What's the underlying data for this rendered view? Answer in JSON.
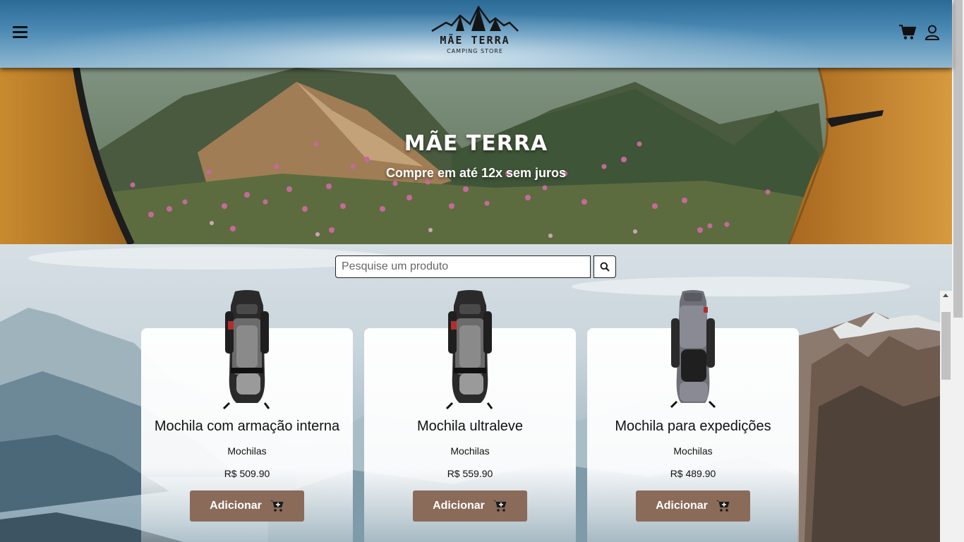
{
  "header": {
    "logo": {
      "title": "MÃE TERRA",
      "subtitle": "CAMPING STORE"
    },
    "icons": {
      "menu": "hamburger-menu-icon",
      "cart": "shopping-cart-icon",
      "user": "user-icon"
    }
  },
  "hero": {
    "title": "MÃE TERRA",
    "subtitle": "Compre em até 12x sem juros"
  },
  "search": {
    "placeholder": "Pesquise um produto",
    "value": "",
    "icon": "search-icon"
  },
  "products": [
    {
      "name": "Mochila com armação interna",
      "category": "Mochilas",
      "price": "R$ 509.90",
      "button_label": "Adicionar"
    },
    {
      "name": "Mochila ultraleve",
      "category": "Mochilas",
      "price": "R$ 559.90",
      "button_label": "Adicionar"
    },
    {
      "name": "Mochila para expedições",
      "category": "Mochilas",
      "price": "R$ 489.90",
      "button_label": "Adicionar"
    }
  ],
  "colors": {
    "button": "#8a6a58",
    "header_blue": "#2a6a95"
  }
}
